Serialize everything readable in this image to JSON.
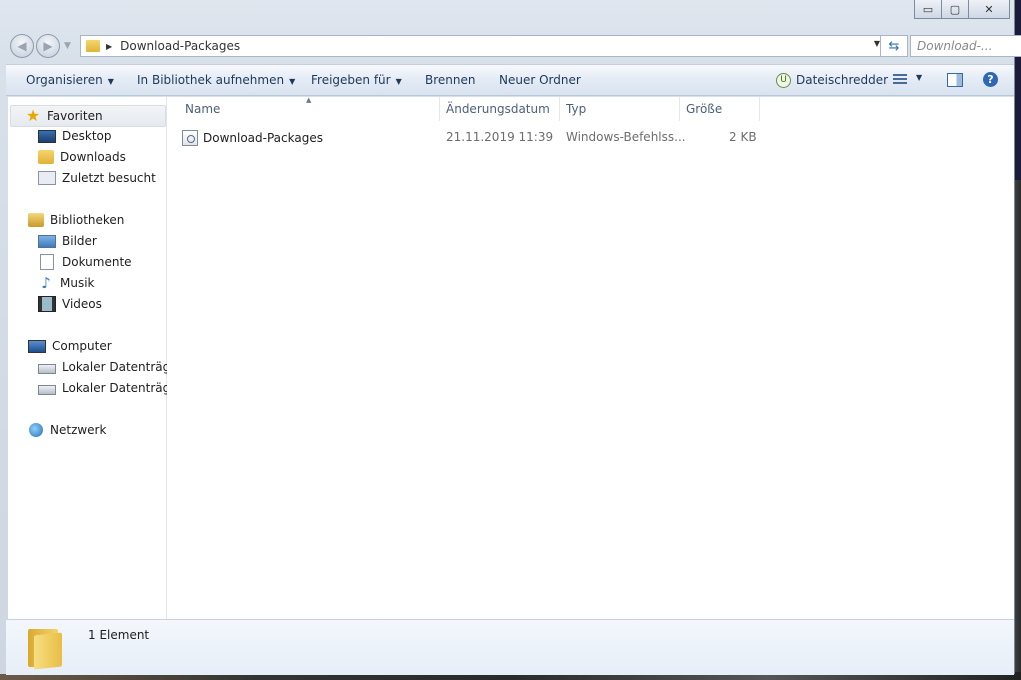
{
  "window": {
    "caption": {
      "minimize": "▭",
      "maximize": "▢",
      "close": "✕"
    }
  },
  "address": {
    "path": "Download-Packages",
    "search_placeholder": "Download-..."
  },
  "toolbar": {
    "organize": "Organisieren",
    "include_library": "In Bibliothek aufnehmen",
    "share": "Freigeben für",
    "burn": "Brennen",
    "new_folder": "Neuer Ordner",
    "shredder": "Dateischredder",
    "help": "?"
  },
  "sidebar": {
    "favorites": {
      "label": "Favoriten",
      "items": [
        {
          "label": "Desktop",
          "icon": "desktop-icon"
        },
        {
          "label": "Downloads",
          "icon": "downloads-folder-icon"
        },
        {
          "label": "Zuletzt besucht",
          "icon": "recent-places-icon"
        }
      ]
    },
    "libraries": {
      "label": "Bibliotheken",
      "items": [
        {
          "label": "Bilder",
          "icon": "pictures-icon"
        },
        {
          "label": "Dokumente",
          "icon": "documents-icon"
        },
        {
          "label": "Musik",
          "icon": "music-icon"
        },
        {
          "label": "Videos",
          "icon": "videos-icon"
        }
      ]
    },
    "computer": {
      "label": "Computer",
      "items": [
        {
          "label": "Lokaler Datenträger",
          "icon": "local-disk-icon"
        },
        {
          "label": "Lokaler Datenträger",
          "icon": "local-disk-icon"
        }
      ]
    },
    "network": {
      "label": "Netzwerk"
    }
  },
  "columns": {
    "name": "Name",
    "date": "Änderungsdatum",
    "type": "Typ",
    "size": "Größe"
  },
  "files": [
    {
      "name": "Download-Packages",
      "date": "21.11.2019 11:39",
      "type": "Windows-Befehlss...",
      "size": "2 KB",
      "icon": "batch-file-icon"
    }
  ],
  "status": {
    "item_count": "1 Element"
  },
  "colors": {
    "command_text": "#1e395b",
    "selected_item_bg": "#e6eaef",
    "help_blue": "#2f66b5"
  }
}
